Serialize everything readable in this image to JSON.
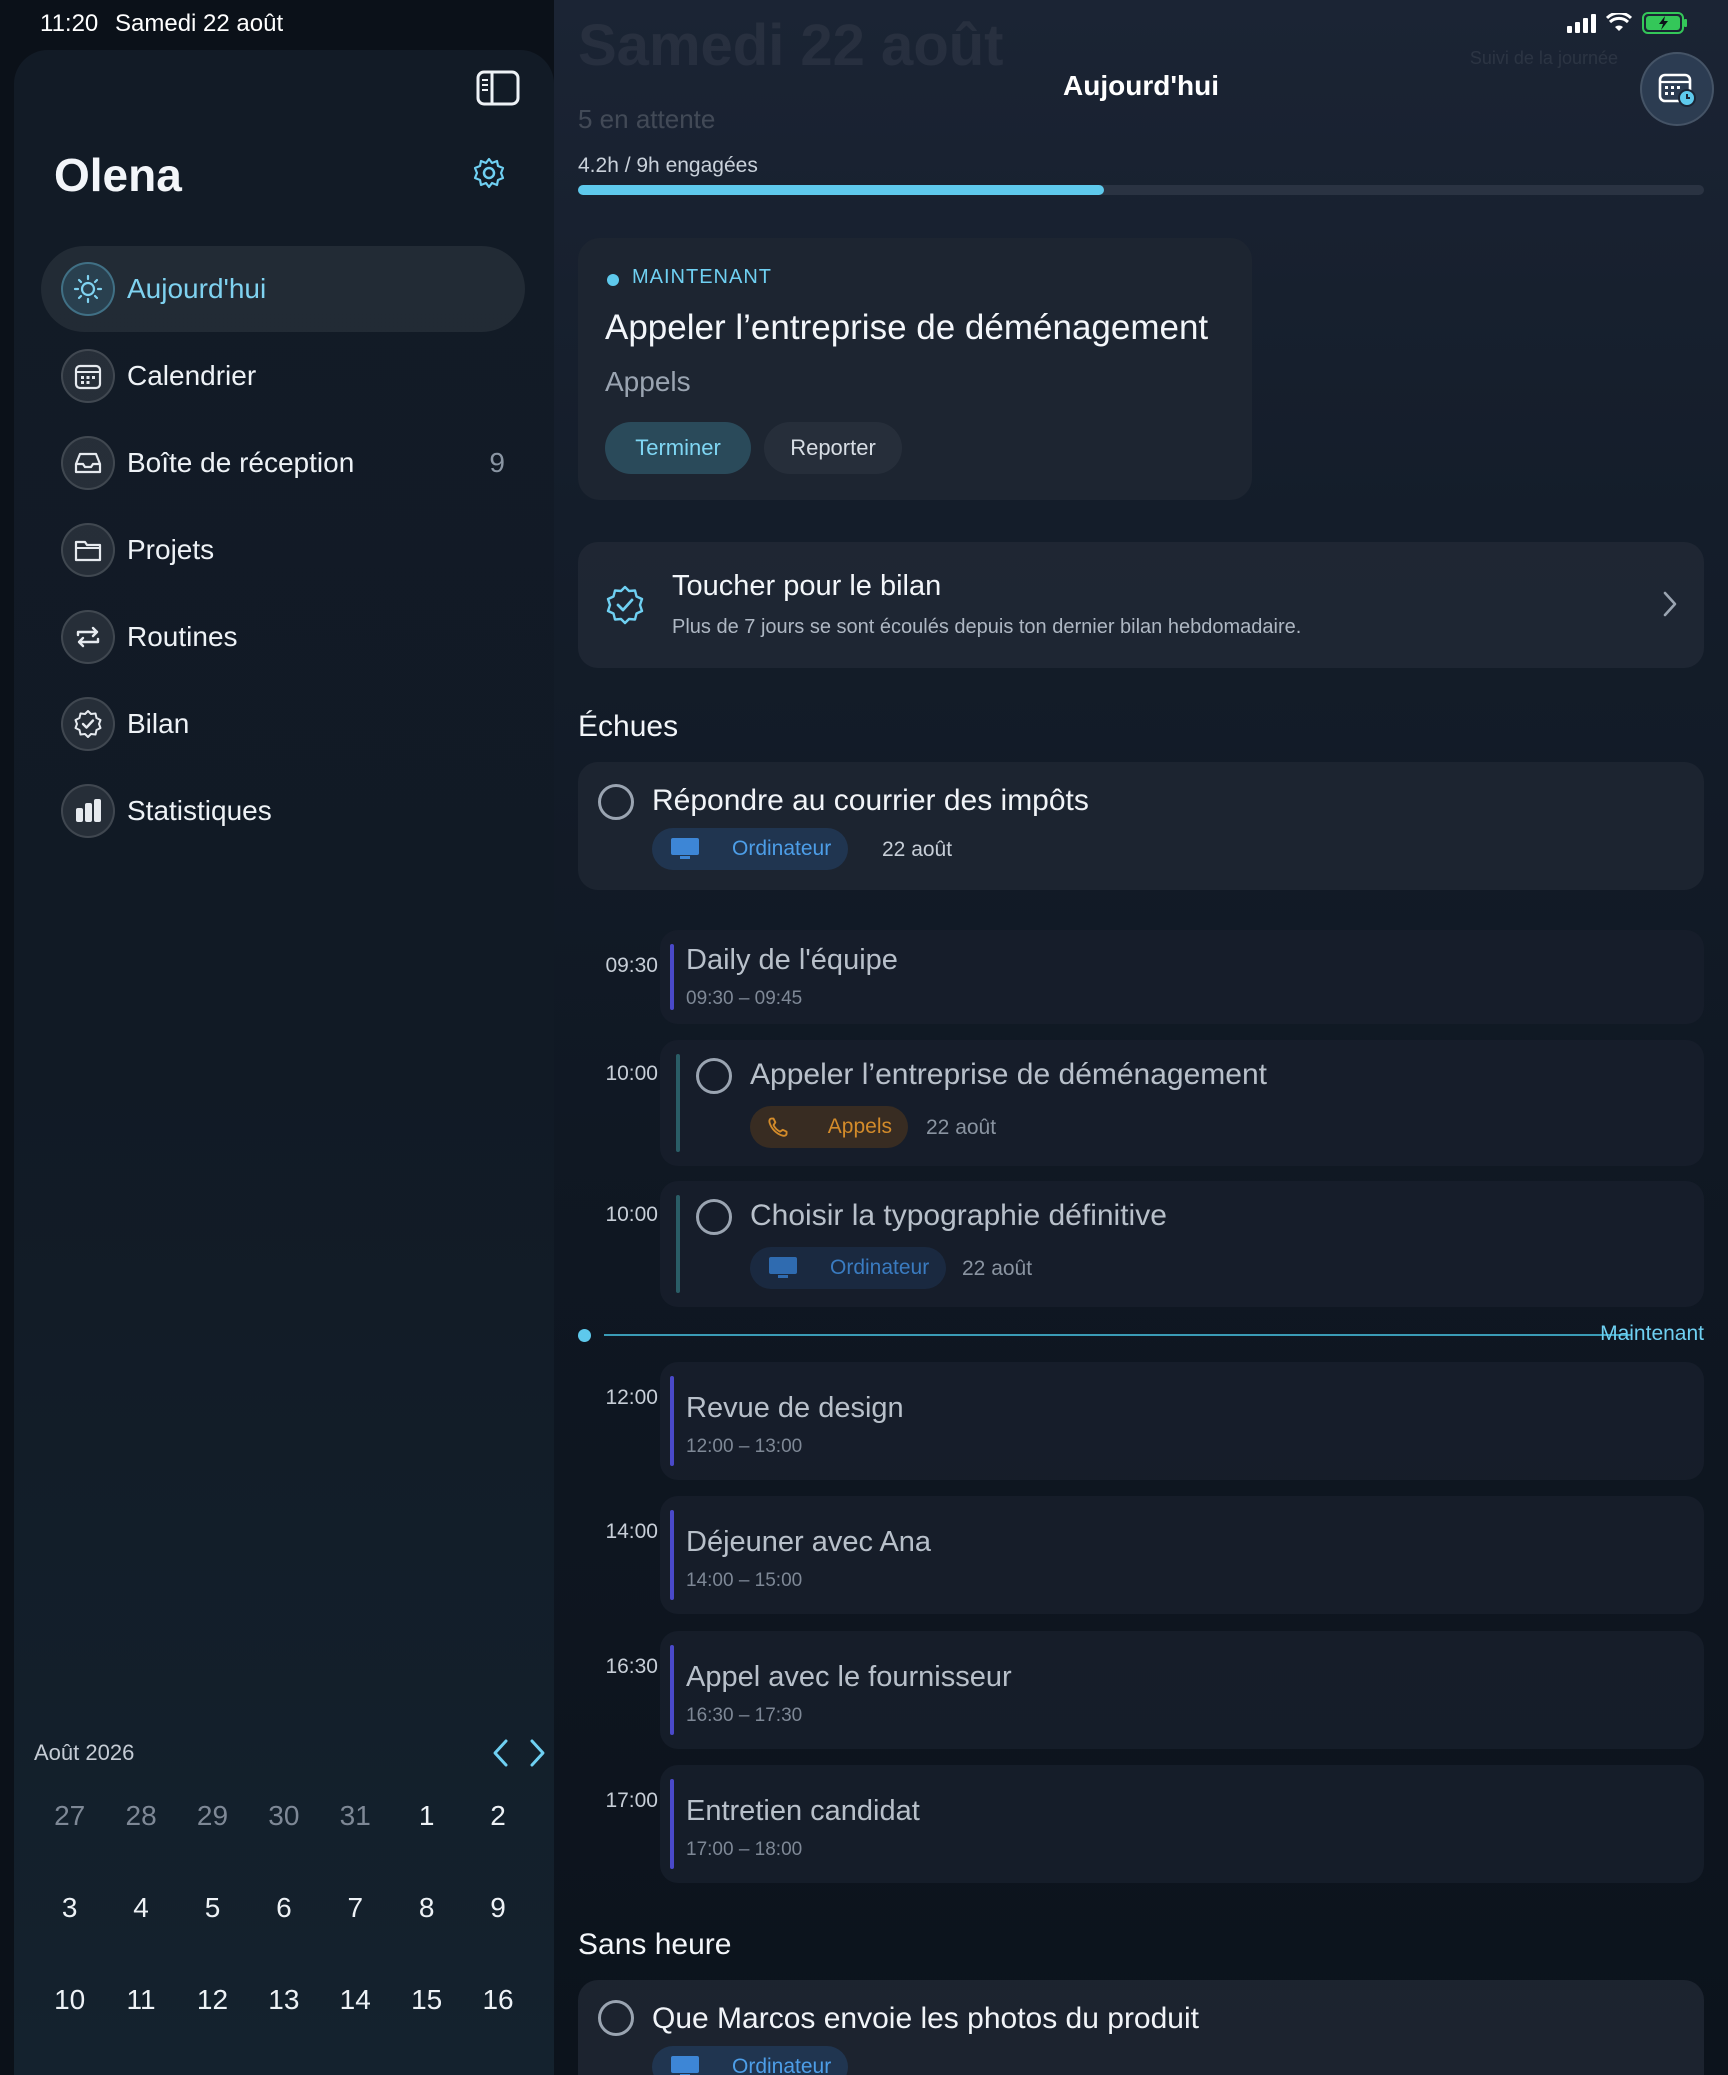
{
  "status": {
    "time": "11:20",
    "date": "Samedi 22 août"
  },
  "sidebar": {
    "user": "Olena",
    "items": [
      {
        "label": "Aujourd'hui",
        "icon": "sun-icon",
        "count": ""
      },
      {
        "label": "Calendrier",
        "icon": "calendar-icon",
        "count": ""
      },
      {
        "label": "Boîte de réception",
        "icon": "inbox-icon",
        "count": "9"
      },
      {
        "label": "Projets",
        "icon": "folder-icon",
        "count": ""
      },
      {
        "label": "Routines",
        "icon": "repeat-icon",
        "count": ""
      },
      {
        "label": "Bilan",
        "icon": "badge-check-icon",
        "count": ""
      },
      {
        "label": "Statistiques",
        "icon": "bar-chart-icon",
        "count": ""
      }
    ],
    "calendar": {
      "month": "Août 2026",
      "weeks": [
        [
          "27",
          "28",
          "29",
          "30",
          "31",
          "1",
          "2"
        ],
        [
          "3",
          "4",
          "5",
          "6",
          "7",
          "8",
          "9"
        ],
        [
          "10",
          "11",
          "12",
          "13",
          "14",
          "15",
          "16"
        ]
      ]
    }
  },
  "header": {
    "ghost_title": "Samedi 22 août",
    "ghost_sub": "5 en attente",
    "ghost_right": "Suivi de la journée",
    "title": "Aujourd'hui"
  },
  "progress": {
    "label": "4.2h / 9h engagées",
    "fraction": 0.467
  },
  "now_card": {
    "label": "MAINTENANT",
    "title": "Appeler l’entreprise de déménagement",
    "category": "Appels",
    "finish": "Terminer",
    "postpone": "Reporter"
  },
  "review": {
    "title": "Toucher pour le bilan",
    "subtitle": "Plus de 7 jours se sont écoulés depuis ton dernier bilan hebdomadaire."
  },
  "overdue": {
    "title": "Échues",
    "task": {
      "title": "Répondre au courrier des impôts",
      "tag": "Ordinateur",
      "date": "22 août"
    }
  },
  "timeline": {
    "events": [
      {
        "time": "09:30",
        "title": "Daily de l'équipe",
        "range": "09:30 – 09:45"
      },
      {
        "time": "12:00",
        "title": "Revue de design",
        "range": "12:00 – 13:00"
      },
      {
        "time": "14:00",
        "title": "Déjeuner avec Ana",
        "range": "14:00 – 15:00"
      },
      {
        "time": "16:30",
        "title": "Appel avec le fournisseur",
        "range": "16:30 – 17:30"
      },
      {
        "time": "17:00",
        "title": "Entretien candidat",
        "range": "17:00 – 18:00"
      }
    ],
    "tasks": [
      {
        "time": "10:00",
        "title": "Appeler l’entreprise de déménagement",
        "tag": "Appels",
        "date": "22 août"
      },
      {
        "time": "10:00",
        "title": "Choisir la typographie définitive",
        "tag": "Ordinateur",
        "date": "22 août"
      }
    ],
    "now_label": "Maintenant"
  },
  "no_time": {
    "title": "Sans heure",
    "task": {
      "title": "Que Marcos envoie les photos du produit",
      "tag": "Ordinateur"
    }
  },
  "colors": {
    "accent": "#5ec9ec",
    "event_bar": "#4a49c9",
    "tag_blue": "#4d9ee8",
    "tag_orange": "#d38b2a"
  }
}
